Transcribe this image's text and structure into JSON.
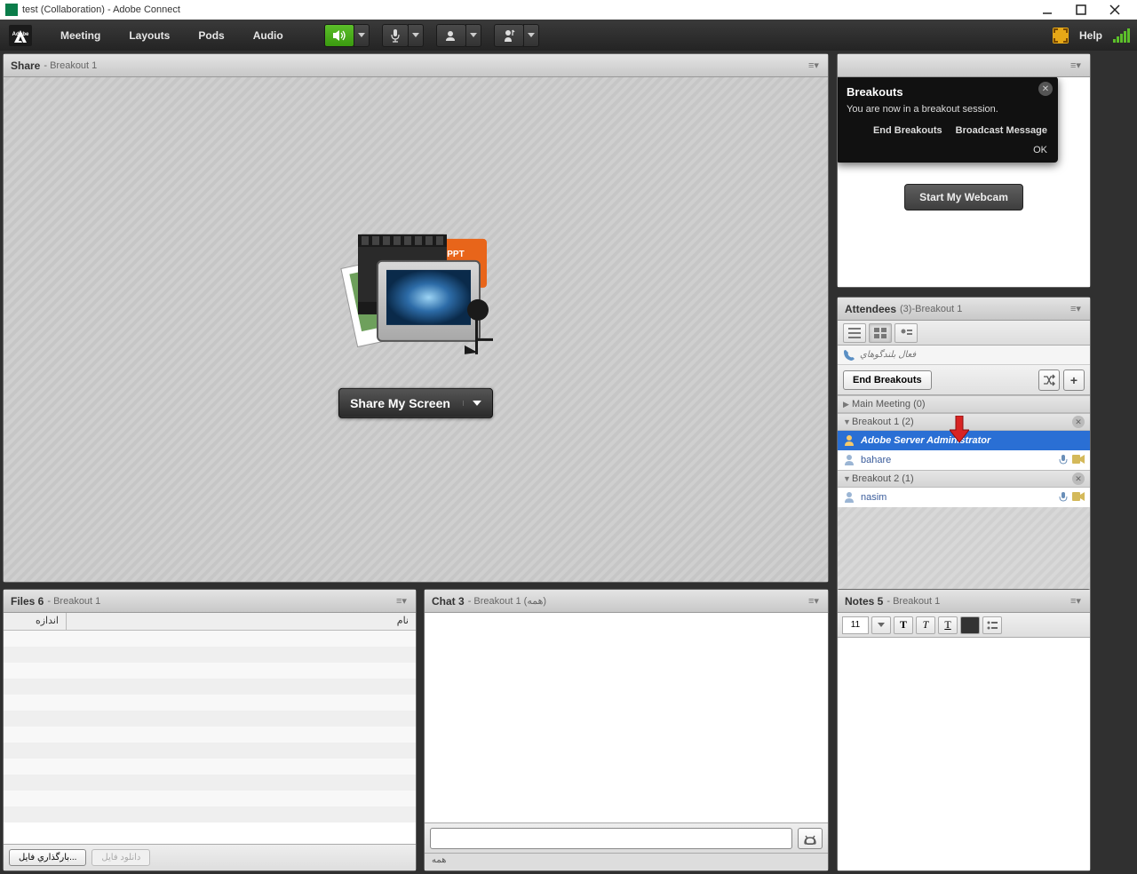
{
  "window": {
    "title": "test (Collaboration) - Adobe Connect"
  },
  "menu": {
    "meeting": "Meeting",
    "layouts": "Layouts",
    "pods": "Pods",
    "audio": "Audio",
    "help": "Help"
  },
  "share": {
    "title": "Share",
    "sub": "- Breakout 1",
    "button": "Share My Screen"
  },
  "webcam": {
    "start": "Start My Webcam"
  },
  "breakout_popover": {
    "title": "Breakouts",
    "body": "You are now in a breakout session.",
    "end": "End Breakouts",
    "broadcast": "Broadcast Message",
    "ok": "OK"
  },
  "attendees": {
    "title": "Attendees",
    "sub": "(3)-Breakout 1",
    "speakers_label": "فعال بلندگوهاي",
    "end_breakouts": "End Breakouts",
    "groups": {
      "main": "Main Meeting (0)",
      "b1": "Breakout 1 (2)",
      "b2": "Breakout 2 (1)"
    },
    "users": {
      "admin": "Adobe Server Administrator",
      "bahare": "bahare",
      "nasim": "nasim"
    }
  },
  "files": {
    "title": "Files 6",
    "sub": "- Breakout 1",
    "col_name": "نام",
    "col_size": "اندازه",
    "upload": "بارگذاري فايل...",
    "download": "دانلود فايل"
  },
  "chat": {
    "title": "Chat 3",
    "sub": "- Breakout 1 (همه)",
    "tab_all": "همه"
  },
  "notes": {
    "title": "Notes 5",
    "sub": "- Breakout 1",
    "font_size": "11"
  }
}
